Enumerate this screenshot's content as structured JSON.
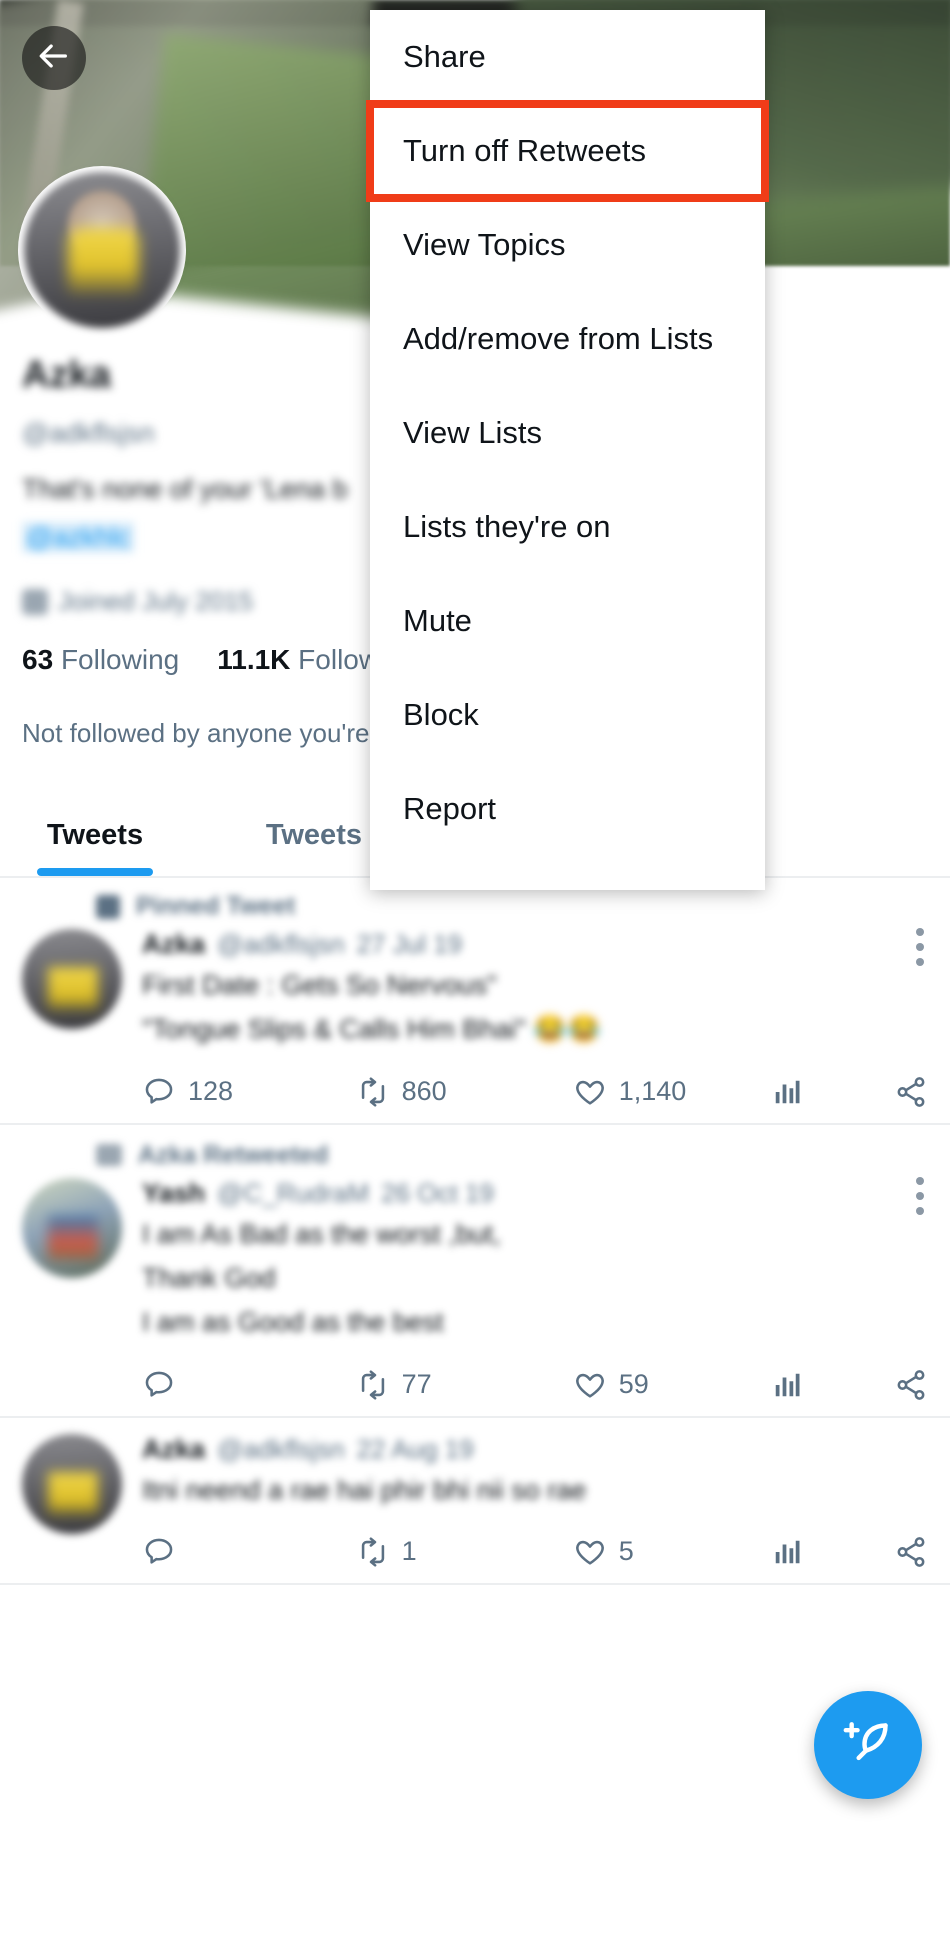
{
  "app": {
    "name": "twitter-profile"
  },
  "header": {
    "back_icon": "back-arrow-icon",
    "banner_alt": "mountain-valley-banner"
  },
  "profile": {
    "display_name": "Azka",
    "handle": "@adkflsjsn",
    "bio_line1": "That's none of your 'Lena b",
    "bio_line2": "@azkhlc",
    "joined": "Joined July 2015",
    "following_count": "63",
    "following_label": "Following",
    "followers_count": "11.1K",
    "followers_label": "Follow",
    "not_followed_text": "Not followed by anyone you're"
  },
  "tabs": [
    {
      "label": "Tweets",
      "active": true
    },
    {
      "label": "Tweets & rep",
      "active": false
    }
  ],
  "tweets": [
    {
      "context_label": "Pinned Tweet",
      "context_icon": "pin-icon",
      "name": "Azka",
      "handle": "@adkflsjsn",
      "timestamp": "27 Jul 19",
      "text_line1": "First Date : Gets So Nervous\"",
      "text_line2": "\"Tongue Slips & Calls Him Bhai\"",
      "emoji": "😂😂",
      "replies": "128",
      "retweets": "860",
      "likes": "1,140",
      "views": "",
      "more_icon": "more-vertical-icon",
      "share_icon": "share-icon",
      "analytics_icon": "analytics-bars-icon"
    },
    {
      "context_label": "Azka Retweeted",
      "context_icon": "retweet-icon",
      "name": "Yash",
      "handle": "@C_RudraM",
      "timestamp": "26 Oct 19",
      "text_line1": "I am As Bad as the worst ,but,",
      "text_line2": "Thank God",
      "text_line3": "I am as Good as the best",
      "emoji": "",
      "replies": "",
      "retweets": "77",
      "likes": "59",
      "views": "",
      "more_icon": "more-vertical-icon",
      "share_icon": "share-icon",
      "analytics_icon": "analytics-bars-icon"
    },
    {
      "context_label": "",
      "context_icon": "",
      "name": "Azka",
      "handle": "@adkflsjsn",
      "timestamp": "22 Aug 19",
      "text_line1": "Itni neend a rae hai phir bhi nii so rae",
      "text_line2": "",
      "text_line3": "",
      "emoji": "",
      "replies": "",
      "retweets": "1",
      "likes": "5",
      "views": "",
      "more_icon": "more-vertical-icon",
      "share_icon": "share-icon",
      "analytics_icon": "analytics-bars-icon"
    }
  ],
  "overflow_menu": {
    "items": [
      {
        "label": "Share",
        "highlighted": false
      },
      {
        "label": "Turn off Retweets",
        "highlighted": true
      },
      {
        "label": "View Topics",
        "highlighted": false
      },
      {
        "label": "Add/remove from Lists",
        "highlighted": false
      },
      {
        "label": "View Lists",
        "highlighted": false
      },
      {
        "label": "Lists they're on",
        "highlighted": false
      },
      {
        "label": "Mute",
        "highlighted": false
      },
      {
        "label": "Block",
        "highlighted": false
      },
      {
        "label": "Report",
        "highlighted": false
      }
    ]
  },
  "compose": {
    "icon": "compose-tweet-icon"
  },
  "colors": {
    "accent": "#1d9bf0",
    "highlight": "#f03c18",
    "text_primary": "#0f1419",
    "text_secondary": "#5b7083"
  }
}
